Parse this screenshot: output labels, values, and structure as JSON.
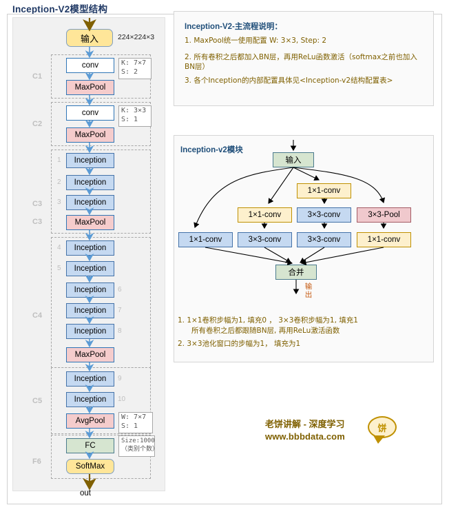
{
  "title": "Inception-V2模型结构",
  "main_flow": {
    "input": {
      "label": "输入",
      "spec": "224×224×3"
    },
    "groups": [
      {
        "id": "C1",
        "label": "C1"
      },
      {
        "id": "C2",
        "label": "C2"
      },
      {
        "id": "C3a",
        "label": "C3"
      },
      {
        "id": "C3b",
        "label": "C3"
      },
      {
        "id": "C4",
        "label": "C4"
      },
      {
        "id": "C5",
        "label": "C5"
      },
      {
        "id": "F6",
        "label": "F6"
      }
    ],
    "c1": {
      "conv": "conv",
      "pool": "MaxPool",
      "spec": "K: 7×7\nS: 2"
    },
    "c2": {
      "conv": "conv",
      "pool": "MaxPool",
      "spec": "K: 3×3\nS: 1"
    },
    "c3": {
      "blocks": [
        "Inception",
        "Inception",
        "Inception"
      ],
      "numbers": [
        "1",
        "2",
        "3"
      ],
      "pool": "MaxPool"
    },
    "c4": {
      "blocks": [
        "Inception",
        "Inception",
        "Inception",
        "Inception",
        "Inception"
      ],
      "numbers": [
        "4",
        "5",
        "6",
        "7",
        "8"
      ],
      "pool": "MaxPool"
    },
    "c5": {
      "blocks": [
        "Inception",
        "Inception"
      ],
      "numbers": [
        "9",
        "10"
      ],
      "pool": "AvgPool",
      "pool_spec": "W: 7×7\nS: 1"
    },
    "f6": {
      "fc": "FC",
      "fc_spec": "Size:1000\n（类别个数）",
      "softmax": "SoftMax"
    },
    "out": "out"
  },
  "notes_top": {
    "title": "Inception-V2-主流程说明：",
    "lines": [
      "1. MaxPool统一使用配置 W: 3×3, Step: 2",
      "2. 所有卷积之后都加入BN层，再用ReLu函数激活（softmax之前也加入BN层）",
      "3. 各个Inception的内部配置具体见<Inception-v2结构配置表>"
    ]
  },
  "module": {
    "title": "Inception-v2模块",
    "input": "输入",
    "row_top": {
      "label": "1×1-conv"
    },
    "row_mid": [
      {
        "label": "1×1-conv"
      },
      {
        "label": "3×3-conv"
      },
      {
        "label": "3×3-Pool"
      }
    ],
    "row_bottom": [
      {
        "label": "1×1-conv"
      },
      {
        "label": "3×3-conv"
      },
      {
        "label": "3×3-conv"
      },
      {
        "label": "1×1-conv"
      }
    ],
    "merge": "合并",
    "output": "输出"
  },
  "notes_bottom": {
    "lines": [
      "1. 1×1卷积步幅为1, 填充0 ， 3×3卷积步幅为1, 填充1",
      "所有卷积之后都跟随BN层, 再用ReLu激活函数",
      "2. 3×3池化窗口的步幅为1， 填充为1"
    ]
  },
  "brand": {
    "line1": "老饼讲解 - 深度学习",
    "line2": "www.bbbdata.com",
    "bubble": "饼"
  },
  "colors": {
    "title": "#1f3864",
    "panel_title": "#1f4e79",
    "note": "#7f6000",
    "yellow": "#ffe699",
    "pink": "#f5cccc",
    "blue": "#c5d9f1",
    "green": "#d6e5d0",
    "cream": "#fdf0cd",
    "arrow_blue": "#4f81bd",
    "arrow_gold": "#806000",
    "group_label": "#bfbfbf"
  }
}
